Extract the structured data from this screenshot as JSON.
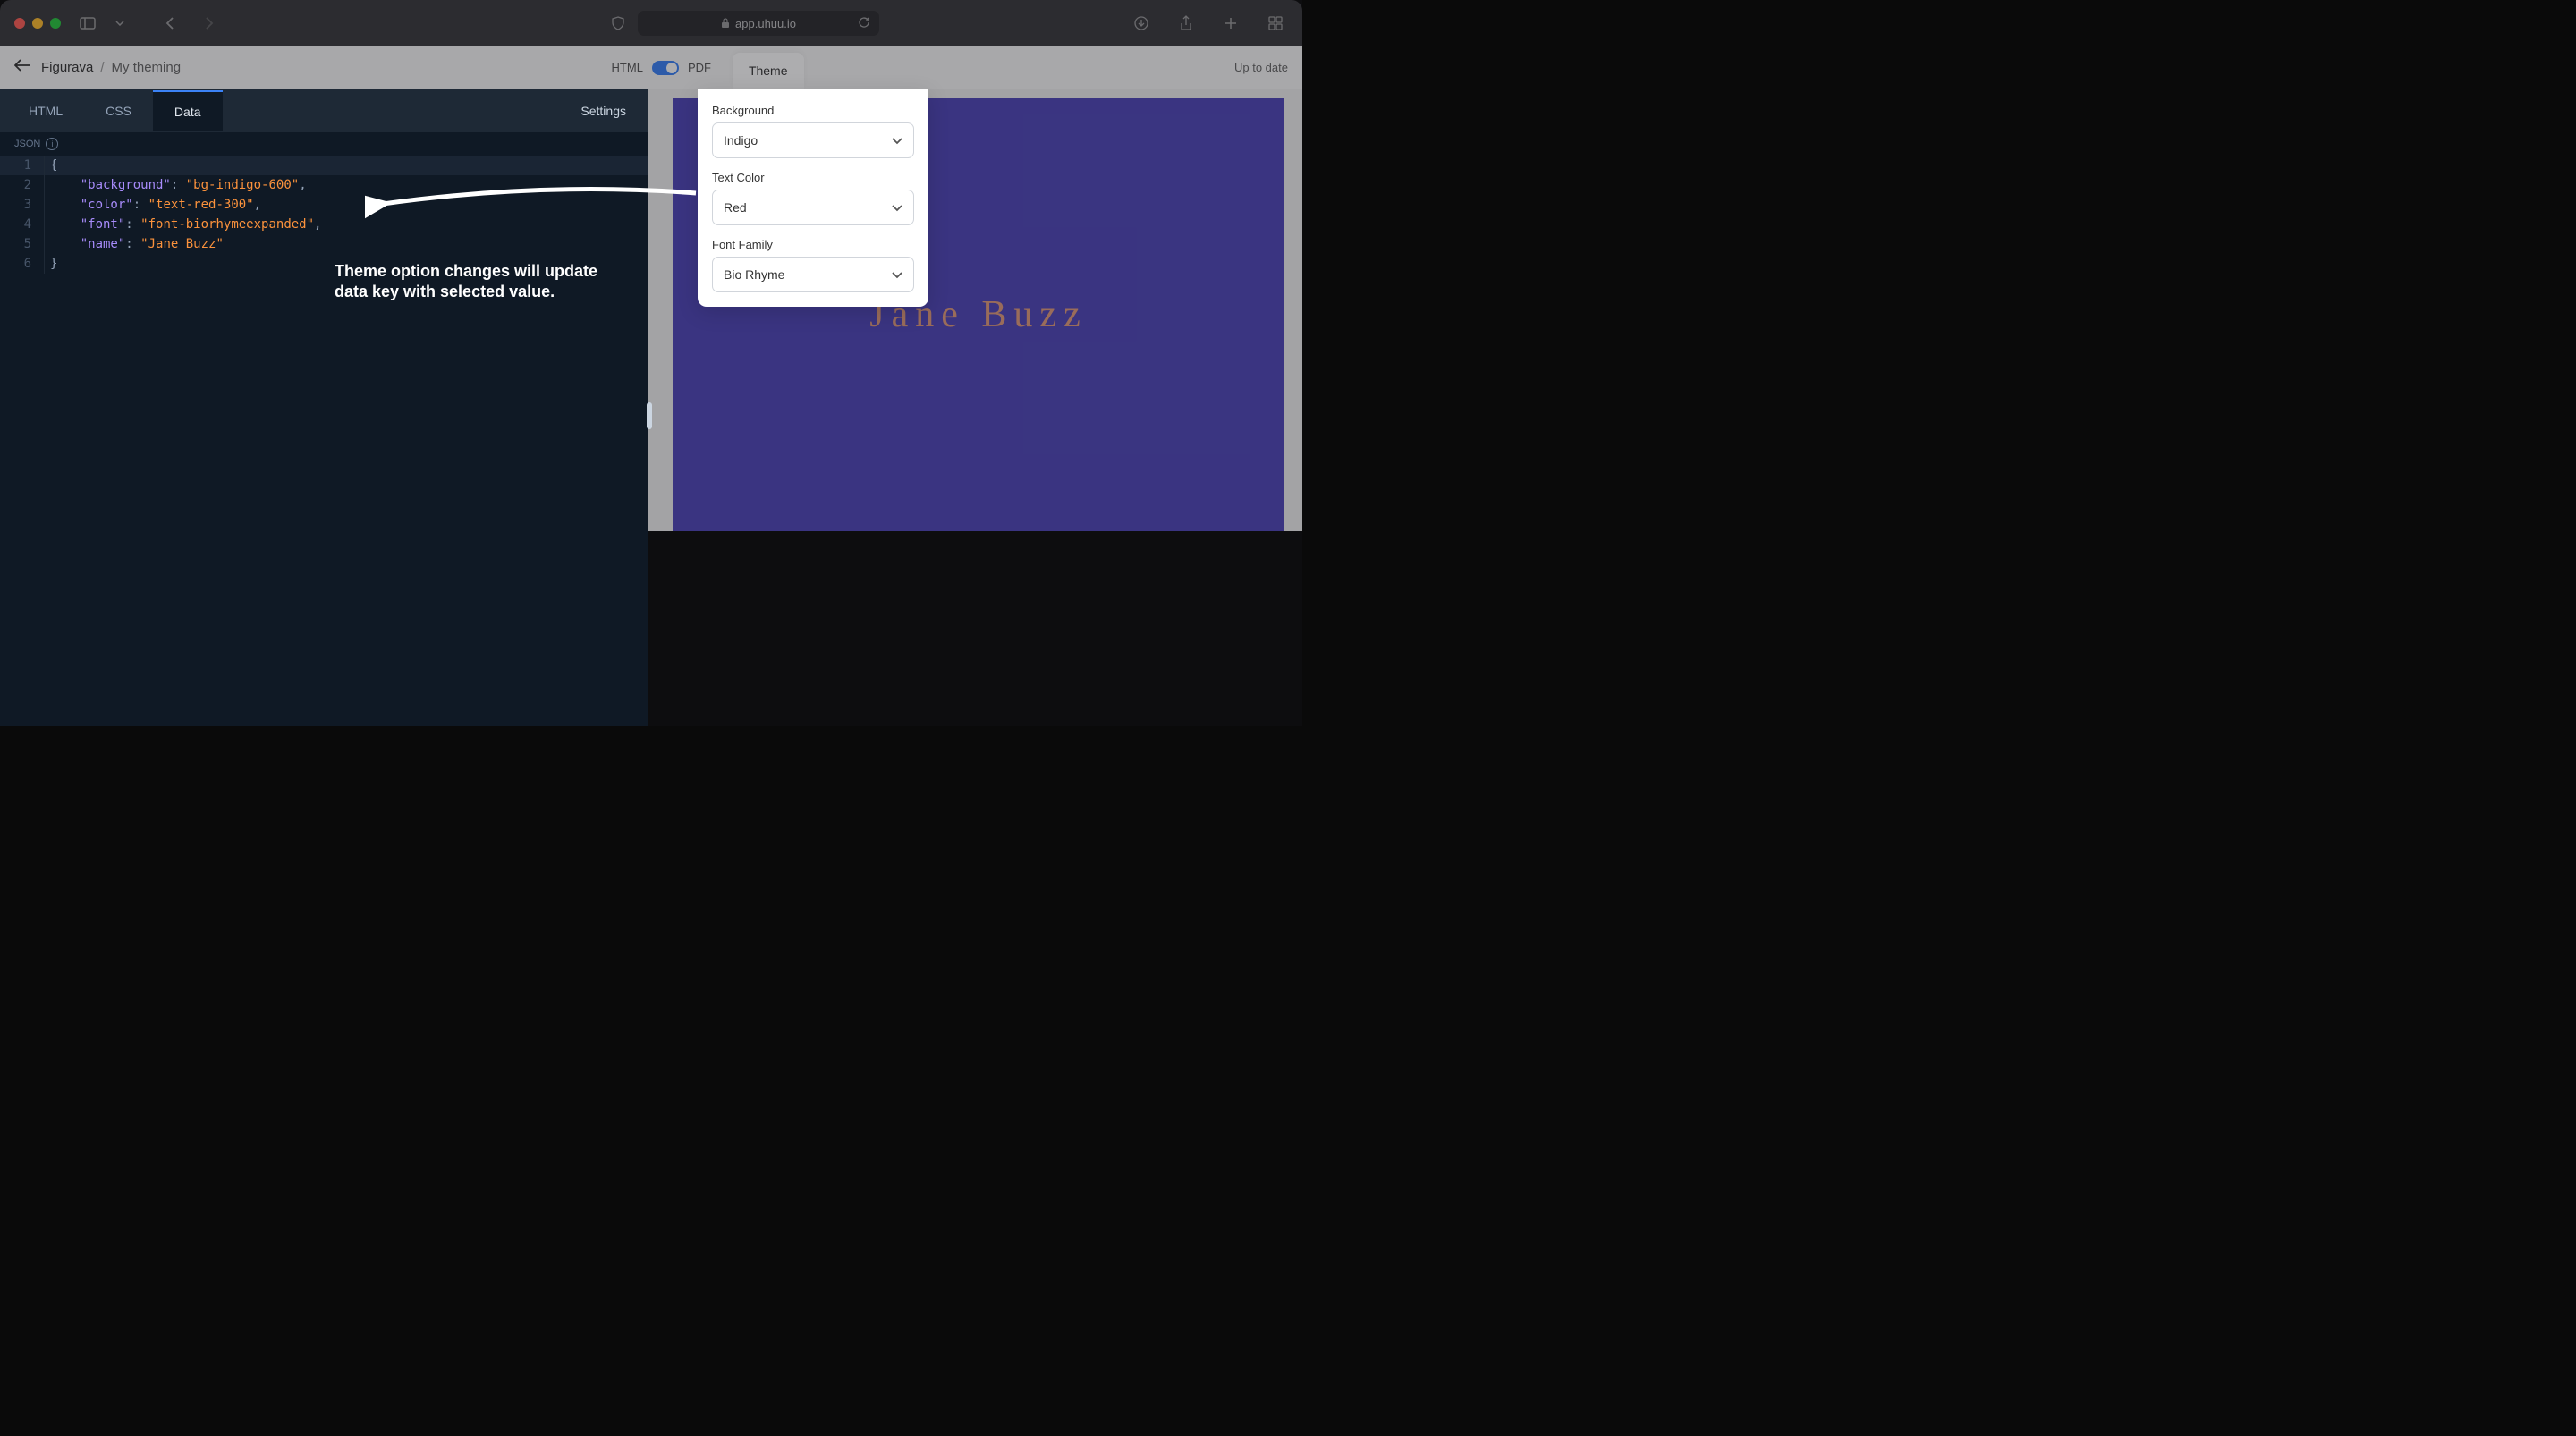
{
  "browser": {
    "url_host": "app.uhuu.io"
  },
  "app_header": {
    "breadcrumb_root": "Figurava",
    "breadcrumb_sep": "/",
    "breadcrumb_current": "My theming",
    "toggle_left": "HTML",
    "toggle_right": "PDF",
    "theme_tab": "Theme",
    "sync_status": "Up to date"
  },
  "editor": {
    "tabs": [
      "HTML",
      "CSS",
      "Data"
    ],
    "active_tab": "Data",
    "settings_label": "Settings",
    "json_label": "JSON",
    "code_lines": [
      {
        "n": 1,
        "content": "{",
        "hl": true
      },
      {
        "n": 2,
        "content": "    \"background\": \"bg-indigo-600\","
      },
      {
        "n": 3,
        "content": "    \"color\": \"text-red-300\","
      },
      {
        "n": 4,
        "content": "    \"font\": \"font-biorhymeexpanded\","
      },
      {
        "n": 5,
        "content": "    \"name\": \"Jane Buzz\""
      },
      {
        "n": 6,
        "content": "}"
      }
    ]
  },
  "annotation": {
    "text": "Theme option changes will update data key with selected value."
  },
  "theme_popover": {
    "fields": [
      {
        "label": "Background",
        "value": "Indigo"
      },
      {
        "label": "Text Color",
        "value": "Red"
      },
      {
        "label": "Font Family",
        "value": "Bio Rhyme"
      }
    ]
  },
  "preview": {
    "display_name": "Jane Buzz"
  }
}
